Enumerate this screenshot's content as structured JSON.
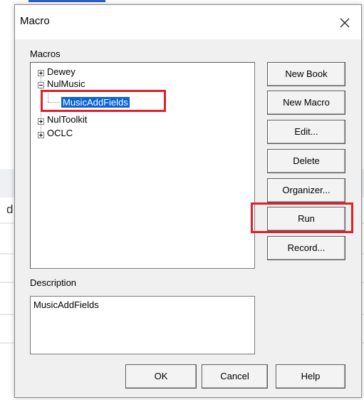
{
  "dialog": {
    "title": "Macro",
    "macros_label": "Macros",
    "description_label": "Description",
    "description_value": "MusicAddFields"
  },
  "tree": {
    "items": [
      {
        "label": "Dewey",
        "expander": "+"
      },
      {
        "label": "NulMusic",
        "expander": "-"
      },
      {
        "label": "MusicAddFields",
        "selected": true
      },
      {
        "label": "NulToolkit",
        "expander": "+"
      },
      {
        "label": "OCLC",
        "expander": "+"
      }
    ]
  },
  "side_buttons": {
    "new_book": "New Book",
    "new_macro": "New Macro",
    "edit": "Edit...",
    "delete": "Delete",
    "organizer": "Organizer...",
    "run": "Run",
    "record": "Record..."
  },
  "bottom_buttons": {
    "ok": "OK",
    "cancel": "Cancel",
    "help": "Help"
  },
  "background": {
    "letter": "d"
  },
  "colors": {
    "selection": "#0a64d8",
    "highlight": "#e0202a"
  },
  "icons": [
    "close-icon",
    "expand-icon",
    "collapse-icon"
  ]
}
